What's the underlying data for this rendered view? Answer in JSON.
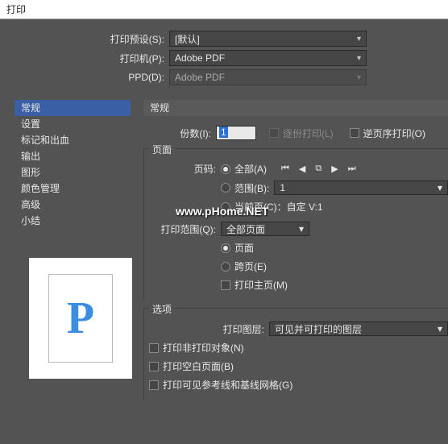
{
  "title": "打印",
  "preset": {
    "label": "打印预设(S):",
    "value": "[默认]"
  },
  "printer": {
    "label": "打印机(P):",
    "value": "Adobe PDF"
  },
  "ppd": {
    "label": "PPD(D):",
    "value": "Adobe PDF"
  },
  "sidebar": {
    "items": [
      {
        "label": "常规",
        "active": true
      },
      {
        "label": "设置"
      },
      {
        "label": "标记和出血"
      },
      {
        "label": "输出"
      },
      {
        "label": "图形"
      },
      {
        "label": "颜色管理"
      },
      {
        "label": "高级"
      },
      {
        "label": "小结"
      }
    ]
  },
  "main_header": "常规",
  "copies": {
    "label": "份数(I):",
    "value": "1"
  },
  "collate": {
    "label": "逐份打印(L)"
  },
  "reverse": {
    "label": "逆页序打印(O)"
  },
  "pages": {
    "legend": "页面",
    "page_num_label": "页码:",
    "all": "全部(A)",
    "range_label": "范围(B):",
    "range_value": "1",
    "current": "当前页(C)：自定 V:1",
    "scope_label": "打印范围(Q):",
    "scope_value": "全部页面",
    "page_radio": "页面",
    "spread": "跨页(E)",
    "master": "打印主页(M)"
  },
  "options": {
    "legend": "选项",
    "layers_label": "打印图层:",
    "layers_value": "可见并可打印的图层",
    "nonprint": "打印非打印对象(N)",
    "blank": "打印空白页面(B)",
    "guides": "打印可见参考线和基线网格(G)"
  },
  "watermark": "www.pHome.NET"
}
